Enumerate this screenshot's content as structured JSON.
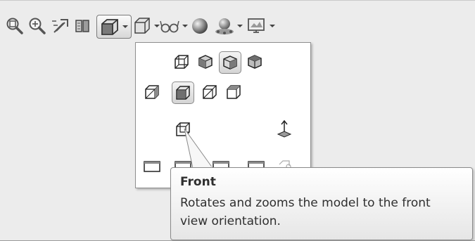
{
  "toolbar": {
    "items": [
      {
        "icon": "zoom-to-fit-icon"
      },
      {
        "icon": "zoom-to-area-icon"
      },
      {
        "icon": "previous-view-icon"
      },
      {
        "icon": "section-view-icon"
      },
      {
        "icon": "view-orientation-icon",
        "has_dropdown": true,
        "active": true
      },
      {
        "icon": "display-style-icon",
        "has_dropdown": true
      },
      {
        "icon": "hide-show-items-icon",
        "has_dropdown": true
      },
      {
        "icon": "edit-appearance-icon"
      },
      {
        "icon": "apply-scene-icon",
        "has_dropdown": true
      },
      {
        "icon": "view-settings-icon",
        "has_dropdown": true
      }
    ]
  },
  "flyout": {
    "rows": [
      [
        "back-view",
        "left-view",
        "top-view-selected-like",
        "right-view"
      ],
      [
        "isometric-view",
        "front-view",
        "trimetric-view",
        "dimetric-view"
      ],
      [
        "bottom-view",
        "normal-to-icon"
      ],
      [
        "single-view",
        "two-view-horizontal",
        "two-view-vertical",
        "four-view",
        "link-views"
      ]
    ],
    "selected": "front-view"
  },
  "tooltip": {
    "title": "Front",
    "description": "Rotates and zooms the model to the front view orientation."
  }
}
